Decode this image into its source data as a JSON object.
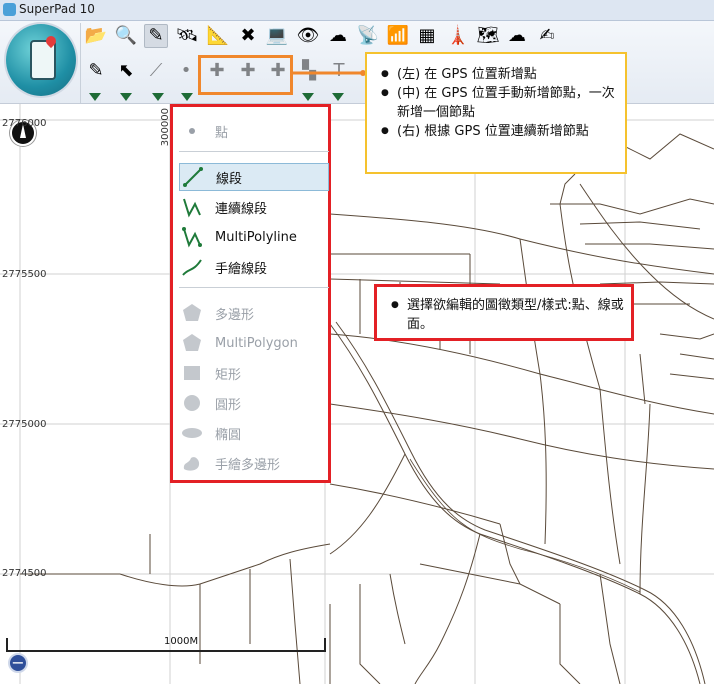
{
  "window": {
    "title": "SuperPad 10"
  },
  "toolbar_row1": [
    {
      "name": "open-folder-icon",
      "glyph": "📂"
    },
    {
      "name": "search-icon",
      "glyph": "🔍"
    },
    {
      "name": "edit-pen-icon",
      "glyph": "✎",
      "selected": true
    },
    {
      "name": "satellite-icon",
      "glyph": "🛰"
    },
    {
      "name": "measure-icon",
      "glyph": "📐"
    },
    {
      "name": "tools-icon",
      "glyph": "✖"
    },
    {
      "name": "laptop-icon",
      "glyph": "💻"
    },
    {
      "name": "layer-eye-icon",
      "glyph": "👁"
    },
    {
      "name": "cloud-sync-icon",
      "glyph": "☁"
    },
    {
      "name": "gps-receiver-icon",
      "glyph": "📡"
    },
    {
      "name": "signal-icon",
      "glyph": "📶"
    },
    {
      "name": "grid-map-icon",
      "glyph": "▦"
    },
    {
      "name": "tower-icon",
      "glyph": "🗼"
    },
    {
      "name": "map-card-icon",
      "glyph": "🗺"
    },
    {
      "name": "cloud-icon",
      "glyph": "☁"
    },
    {
      "name": "signature-pen-icon",
      "glyph": "✍"
    }
  ],
  "toolbar_row2": [
    {
      "name": "edit-line-pen-icon",
      "glyph": "✎"
    },
    {
      "name": "select-arrow-icon",
      "glyph": "⬉"
    },
    {
      "name": "node-edit-icon",
      "glyph": "⟋",
      "disabled": true
    },
    {
      "name": "point-icon",
      "glyph": "•",
      "disabled": true
    },
    {
      "name": "gps-add-point-icon",
      "glyph": "✚",
      "disabled": true
    },
    {
      "name": "gps-manual-add-vertex-icon",
      "glyph": "✚",
      "disabled": true
    },
    {
      "name": "gps-continuous-add-vertex-icon",
      "glyph": "✚",
      "disabled": true
    },
    {
      "name": "stamp-icon",
      "glyph": "▚",
      "disabled": true
    },
    {
      "name": "text-tool-icon",
      "glyph": "T",
      "disabled": true
    }
  ],
  "map": {
    "y_coords": [
      "2776000",
      "2775500",
      "2775000",
      "2774500"
    ],
    "x_coord": "300000",
    "scale_label": "1000M"
  },
  "feature_menu": {
    "items": [
      {
        "label": "點",
        "icon": "point-icon",
        "disabled": true
      },
      {
        "label": "線段",
        "icon": "line-segment-icon",
        "selected": true
      },
      {
        "label": "連續線段",
        "icon": "polyline-icon"
      },
      {
        "label": "MultiPolyline",
        "icon": "multipolyline-icon"
      },
      {
        "label": "手繪線段",
        "icon": "freehand-line-icon"
      },
      {
        "label": "多邊形",
        "icon": "polygon-icon",
        "disabled": true
      },
      {
        "label": "MultiPolygon",
        "icon": "multipolygon-icon",
        "disabled": true
      },
      {
        "label": "矩形",
        "icon": "rectangle-icon",
        "disabled": true
      },
      {
        "label": "圓形",
        "icon": "circle-icon",
        "disabled": true
      },
      {
        "label": "橢圓",
        "icon": "ellipse-icon",
        "disabled": true
      },
      {
        "label": "手繪多邊形",
        "icon": "freehand-polygon-icon",
        "disabled": true
      }
    ]
  },
  "callout_gps": {
    "items": [
      "(左) 在 GPS 位置新增點",
      "(中) 在 GPS 位置手動新增節點，一次新增一個節點",
      "(右) 根據 GPS 位置連續新增節點"
    ]
  },
  "callout_feature": {
    "items": [
      "選擇欲編輯的圖徵類型/樣式:點、線或面。"
    ]
  },
  "colors": {
    "highlight_red": "#e32025",
    "highlight_orange": "#f0872c",
    "callout_yellow": "#f5c22e",
    "road": "#5a4a3a"
  }
}
